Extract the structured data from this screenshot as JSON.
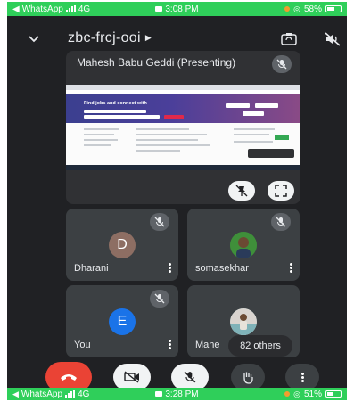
{
  "status_top": {
    "app": "WhatsApp",
    "network": "4G",
    "time": "3:08 PM",
    "battery": "58%",
    "battery_level": 0.58
  },
  "status_bottom": {
    "app": "WhatsApp",
    "network": "4G",
    "time": "3:28 PM",
    "battery": "51%",
    "battery_level": 0.51
  },
  "meeting": {
    "code": "zbc-frcj-ooi"
  },
  "presenter": {
    "label": "Mahesh Babu Geddi (Presenting)",
    "screen_headline": "Find jobs and connect with"
  },
  "participants": [
    {
      "name": "Dharani",
      "initial": "D",
      "avatar_color": "#8d6e63"
    },
    {
      "name": "somasekhar",
      "initial": "",
      "avatar_color": "#2e7d32"
    },
    {
      "name": "You",
      "initial": "E",
      "avatar_color": "#1a73e8"
    },
    {
      "name": "Mahe",
      "initial": "",
      "avatar_color": "#6aa0a8"
    }
  ],
  "others": {
    "label": "82 others"
  },
  "colors": {
    "background": "#202124",
    "tile": "#3c4043",
    "end_call": "#ea4335",
    "status_bar": "#2fcf5a"
  },
  "icons": {
    "back": "chevron-down-icon",
    "switch_camera": "flip-camera-icon",
    "audio_off": "speaker-off-icon",
    "mic_off": "mic-off-icon",
    "pin": "pin-off-icon",
    "fullscreen": "fullscreen-icon",
    "end_call": "hang-up-icon",
    "camera": "camera-off-icon",
    "raise_hand": "raise-hand-icon",
    "more": "more-vert-icon"
  }
}
